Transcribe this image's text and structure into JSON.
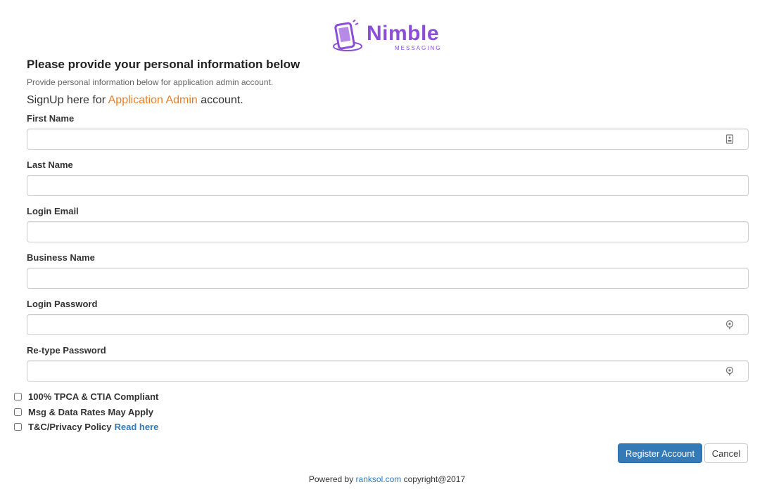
{
  "logo": {
    "name": "Nimble",
    "tagline": "MESSAGING",
    "color": "#8a4fd6"
  },
  "header": {
    "title": "Please provide your personal information below",
    "subtitle": "Provide personal information below for application admin account.",
    "signup_prefix": "SignUp here for ",
    "signup_accent": "Application Admin",
    "signup_suffix": " account."
  },
  "fields": [
    {
      "label": "First Name",
      "value": "",
      "icon": "contact-card-icon"
    },
    {
      "label": "Last Name",
      "value": ""
    },
    {
      "label": "Login Email",
      "value": ""
    },
    {
      "label": "Business Name",
      "value": ""
    },
    {
      "label": "Login Password",
      "value": "",
      "icon": "password-key-icon"
    },
    {
      "label": "Re-type Password",
      "value": "",
      "icon": "password-key-icon"
    }
  ],
  "checkboxes": [
    {
      "label": "100% TPCA & CTIA Compliant",
      "checked": false
    },
    {
      "label": "Msg & Data Rates May Apply",
      "checked": false
    },
    {
      "label": "T&C/Privacy Policy",
      "link": "Read here",
      "checked": false
    }
  ],
  "buttons": {
    "register": "Register Account",
    "cancel": "Cancel"
  },
  "footer": {
    "prefix": "Powered by ",
    "link": "ranksol.com",
    "suffix": " copyright@2017"
  },
  "colors": {
    "accent": "#e87e2a",
    "primary": "#337ab7",
    "brand": "#8a4fd6"
  }
}
